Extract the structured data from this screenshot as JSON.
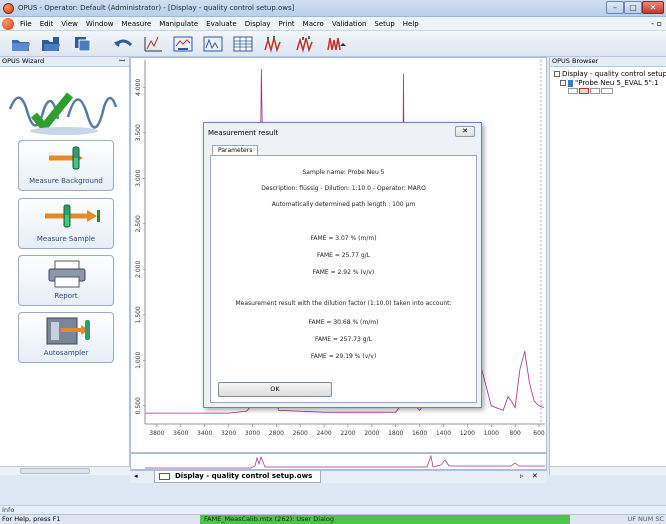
{
  "window": {
    "title": "OPUS - Operator: Default  (Administrator) - [Display - quality control setup.ows]",
    "min_glyph": "–",
    "max_glyph": "□",
    "close_glyph": "✕"
  },
  "menu": {
    "items": [
      "File",
      "Edit",
      "View",
      "Window",
      "Measure",
      "Manipulate",
      "Evaluate",
      "Display",
      "Print",
      "Macro",
      "Validation",
      "Setup",
      "Help"
    ],
    "restore_glyph": "- ▫"
  },
  "toolbar": {
    "icons": [
      "open-folder-icon",
      "save-folder-icon",
      "copy-windows-icon",
      "undo-arrow-icon",
      "crosshair-icon",
      "zoom-icon",
      "spectrum-icon",
      "table-icon",
      "peak-pick-icon",
      "peak-pick-2-icon",
      "multi-peak-icon"
    ]
  },
  "wizard": {
    "title": "OPUS Wizard",
    "pin_glyph": "ꟷ",
    "buttons": [
      {
        "label": "Measure Background"
      },
      {
        "label": "Measure Sample"
      },
      {
        "label": "Report"
      },
      {
        "label": "Autosampler"
      }
    ]
  },
  "chart_data": {
    "type": "line",
    "x_ticks": [
      "3800",
      "3600",
      "3400",
      "3200",
      "3000",
      "2800",
      "2600",
      "2400",
      "2200",
      "2000",
      "1800",
      "1600",
      "1400",
      "1200",
      "1000",
      "800",
      "600"
    ],
    "y_ticks": [
      "0.500",
      "1.000",
      "1.500",
      "2.000",
      "2.500",
      "3.000",
      "3.500",
      "4.000"
    ],
    "xlim": [
      3900,
      550
    ],
    "ylim": [
      0.3,
      4.3
    ],
    "series_color": "#a0308a",
    "x": [
      3900,
      3200,
      3050,
      3010,
      2990,
      2960,
      2940,
      2925,
      2910,
      2880,
      2855,
      2840,
      2820,
      2780,
      2400,
      1800,
      1760,
      1745,
      1740,
      1735,
      1725,
      1700,
      1600,
      1480,
      1460,
      1440,
      1400,
      1380,
      1300,
      1250,
      1200,
      1170,
      1120,
      1100,
      1000,
      900,
      860,
      830,
      800,
      760,
      720,
      680,
      640,
      600,
      560
    ],
    "y": [
      0.42,
      0.42,
      0.44,
      0.5,
      0.7,
      1.3,
      2.4,
      4.2,
      2.8,
      1.4,
      3.1,
      1.2,
      0.6,
      0.45,
      0.43,
      0.43,
      0.5,
      1.2,
      3.2,
      4.15,
      2.0,
      0.6,
      0.45,
      0.65,
      1.05,
      0.8,
      0.55,
      0.7,
      0.5,
      0.75,
      0.95,
      1.6,
      0.9,
      1.0,
      0.5,
      0.45,
      0.6,
      0.55,
      0.48,
      0.9,
      1.1,
      0.75,
      0.55,
      0.5,
      0.48
    ]
  },
  "document_tab": {
    "label": "Display - quality control setup.ows",
    "left_arrow": "◂",
    "right_arrow": "▹",
    "close_glyph": "✕"
  },
  "browser": {
    "title": "OPUS Browser",
    "root": "Display - quality control setup.ows",
    "child": "\"Probe Neu 5_EVAL 5\":1"
  },
  "dialog": {
    "title": "Measurement result",
    "close_glyph": "✕",
    "tab": "Parameters",
    "sample_name": "Sample name: Probe Neu 5",
    "description": "Description: flüssig - Dilution: 1:10.0 - Operator: MARO",
    "path_length": "Automatically determined path length : 100 µm",
    "result_1": "FAME = 3.07 % (m/m)",
    "result_2": "FAME = 25.77 g/L",
    "result_3": "FAME = 2.92 % (v/v)",
    "dilution_note": "Measurement result with the dilution factor (1:10.0) taken into account:",
    "result_4": "FAME = 30.68 % (m/m)",
    "result_5": "FAME = 257.73 g/L",
    "result_6": "FAME = 29.19 % (v/v)",
    "ok": "OK"
  },
  "info": {
    "label": "Info"
  },
  "status": {
    "help": "For Help, press F1",
    "task": "FAME_MeasCalib.mtx (262): User Dialog",
    "keys": "UF NUM SC"
  }
}
